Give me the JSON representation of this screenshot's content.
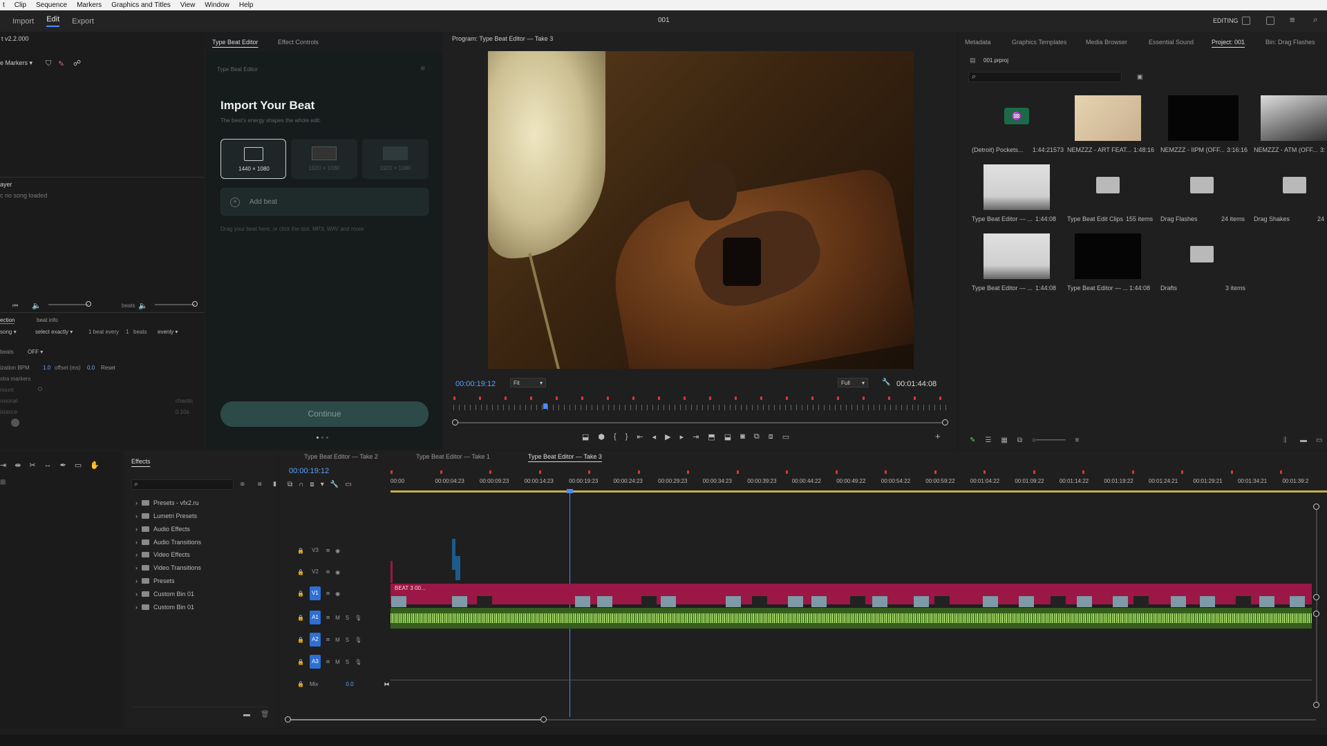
{
  "menu": [
    "t",
    "Clip",
    "Sequence",
    "Markers",
    "Graphics and Titles",
    "View",
    "Window",
    "Help"
  ],
  "workspace": {
    "tabs": [
      "Import",
      "Edit",
      "Export"
    ],
    "active": "Edit",
    "title": "001",
    "mode": "EDITING"
  },
  "left_panel": {
    "version": "t v2.2.000",
    "markers_label": "e Markers",
    "player_label": "ayer",
    "no_song": "c   no song loaded",
    "beats_label": "beats",
    "tabs": [
      "ection",
      "beat info"
    ],
    "opt_song": "song",
    "opt_select": "select exactly",
    "opt_every_prefix": "1 beat every",
    "opt_every_n": "1",
    "opt_every_suffix": "beats",
    "opt_evenly": "evenly",
    "beats_row": "beats",
    "beats_value": "OFF",
    "bpm_label": "ization    BPM",
    "bpm_value": "1.0",
    "offset_label": "offset (ms)",
    "offset_value": "0.0",
    "reset": "Reset",
    "extra_markers": "xtra markers",
    "r1": "nount",
    "r2": "nsional",
    "r2v": "chaotic",
    "r3": "istance",
    "r3v": "0.10s"
  },
  "beat_editor": {
    "tabs": [
      "Type Beat Editor",
      "Effect Controls"
    ],
    "panel_title": "Type Beat Editor",
    "heading": "Import Your Beat",
    "subheading": "The beat's energy shapes the whole edit.",
    "formats": [
      "1440 × 1080",
      "1920 × 1080",
      "1920 × 1080"
    ],
    "add_beat": "Add beat",
    "hint": "Drag your beat here, or click the slot. MP3, WAV and more.",
    "continue": "Continue"
  },
  "program": {
    "title": "Program: Type Beat Editor — Take 3",
    "timecode": "00:00:19:12",
    "fit": "Fit",
    "quality": "Full",
    "duration": "00:01:44:08"
  },
  "project": {
    "tabs": [
      "Metadata",
      "Graphics Templates",
      "Media Browser",
      "Essential Sound",
      "Project: 001",
      "Bin: Drag Flashes"
    ],
    "file": "001.prproj",
    "items": [
      {
        "name": "(Detroit) Pockets...",
        "meta": "1:44:21573"
      },
      {
        "name": "NEMZZZ - ART FEAT...",
        "meta": "1:48:16"
      },
      {
        "name": "NEMZZZ - IIPM (OFF...",
        "meta": "3:16:16"
      },
      {
        "name": "NEMZZZ - ATM (OFF...",
        "meta": "3:"
      },
      {
        "name": "Type Beat Editor — ...",
        "meta": "1:44:08"
      },
      {
        "name": "Type Beat Edit Clips",
        "meta": "155 items"
      },
      {
        "name": "Drag Flashes",
        "meta": "24 items"
      },
      {
        "name": "Drag Shakes",
        "meta": "24"
      },
      {
        "name": "Type Beat Editor — ...",
        "meta": "1:44:08"
      },
      {
        "name": "Type Beat Editor — ...",
        "meta": "1:44:08"
      },
      {
        "name": "Drafts",
        "meta": "3 items"
      }
    ]
  },
  "effects": {
    "title": "Effects",
    "items": [
      "Presets - vfx2.ru",
      "Lumetri Presets",
      "Audio Effects",
      "Audio Transitions",
      "Video Effects",
      "Video Transitions",
      "Presets",
      "Custom Bin 01",
      "Custom Bin 01"
    ]
  },
  "timeline": {
    "tabs": [
      "Type Beat Editor — Take 2",
      "Type Beat Editor — Take 1",
      "Type Beat Editor — Take 3"
    ],
    "timecode": "00:00:19:12",
    "ruler": [
      "00:00",
      "00:00:04:23",
      "00:00:09:23",
      "00:00:14:23",
      "00:00:19:23",
      "00:00:24:23",
      "00:00:29:23",
      "00:00:34:23",
      "00:00:39:23",
      "00:00:44:22",
      "00:00:49:22",
      "00:00:54:22",
      "00:00:59:22",
      "00:01:04:22",
      "00:01:09:22",
      "00:01:14:22",
      "00:01:19:22",
      "00:01:24:21",
      "00:01:29:21",
      "00:01:34:21",
      "00:01:39:2"
    ],
    "tracks": [
      "V3",
      "V2",
      "V1",
      "A1",
      "A2",
      "A3"
    ],
    "mix": "Mix",
    "mix_value": "0.0",
    "clip_label": "BEAT 3 00..."
  }
}
